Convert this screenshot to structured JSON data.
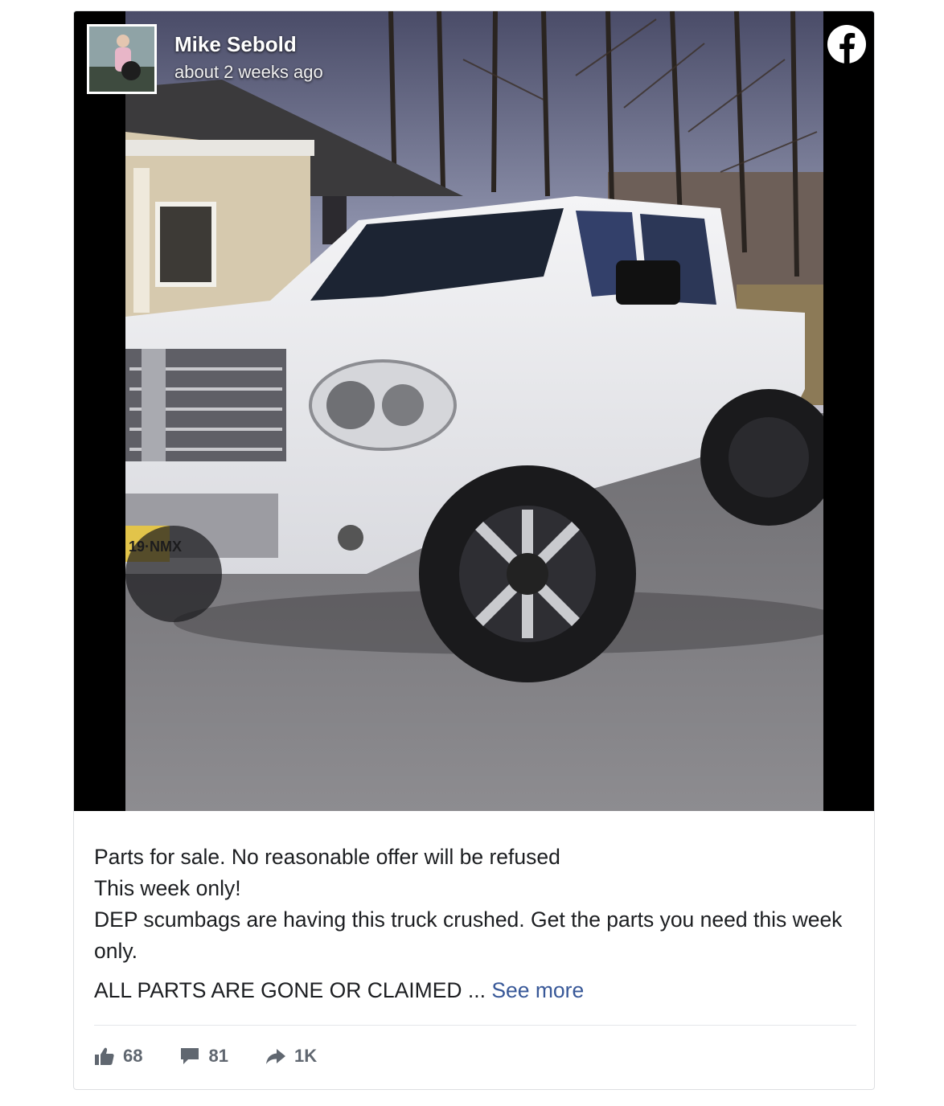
{
  "post": {
    "author": "Mike Sebold",
    "timestamp": "about 2 weeks ago",
    "lines": [
      "Parts for sale. No reasonable offer will be refused",
      "This week only!",
      "DEP scumbags are having this truck crushed. Get the parts you need this week only."
    ],
    "last_line": "ALL PARTS ARE GONE OR CLAIMED ...",
    "see_more": "See more",
    "plate_text": "19·NMX"
  },
  "stats": {
    "likes": "68",
    "comments": "81",
    "shares": "1K"
  },
  "icons": [
    "facebook-logo-icon",
    "like-icon",
    "comment-icon",
    "share-icon"
  ],
  "colors": {
    "link": "#385898",
    "text": "#1c1e21",
    "muted": "#606770",
    "border": "#dddfe2"
  }
}
